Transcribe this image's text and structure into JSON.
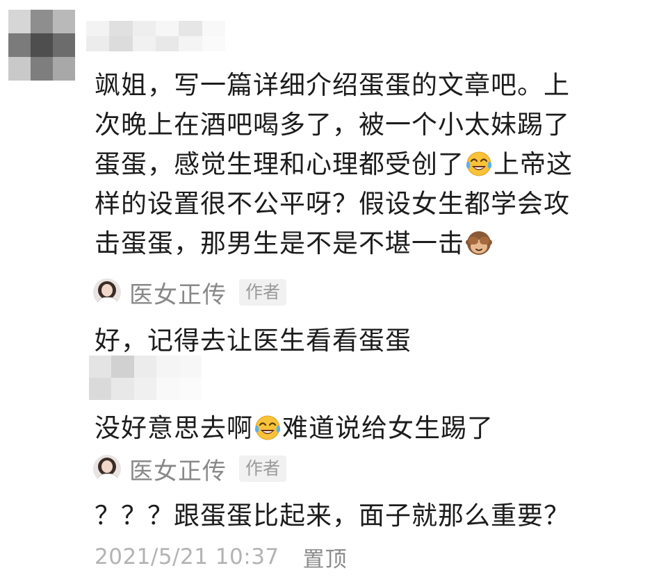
{
  "top_comment": {
    "lines": [
      "飒姐，写一篇详细介绍蛋蛋的文章吧。上",
      "次晚上在酒吧喝多了，被一个小太妹踢了",
      "蛋蛋，感觉生理和心理都受创了",
      "上帝这",
      "样的设置很不公平呀？假设女生都学会攻",
      "击蛋蛋，那男生是不是不堪一击"
    ],
    "emojis": [
      "tears-of-joy-emoji",
      "see-no-evil-monkey-emoji"
    ]
  },
  "author": {
    "name": "医女正传",
    "badge": "作者"
  },
  "replies": [
    {
      "text": "好，记得去让医生看看蛋蛋"
    },
    {
      "text_before": "没好意思去啊",
      "text_after": "难道说给女生踢了",
      "emoji": "tears-of-joy-emoji"
    },
    {
      "text": "？？？跟蛋蛋比起来，面子就那么重要？"
    }
  ],
  "meta": {
    "timestamp": "2021/5/21 10:37",
    "pin_label": "置顶"
  },
  "colors": {
    "text": "#1c1c1c",
    "author_name": "#888888",
    "badge_bg": "#f1f1f1",
    "badge_text": "#9a9a9a",
    "timestamp": "#b3b3b3",
    "pin": "#8b8b8b",
    "emoji_yellow": "#f8c23a"
  },
  "pixelation": {
    "top_avatar": [
      "#d6d6d6",
      "#8e8e8e",
      "#b9b9b9",
      "#7b7b7b",
      "#4e4e4e",
      "#6d6c6c",
      "#c9c9c9",
      "#7e7e7e",
      "#a8a8a8"
    ],
    "top_username": [
      "#f3f3f3",
      "#e0e0e0",
      "#eeeeee",
      "#f6f6f6",
      "#e6e6e6",
      "#f8f8f8",
      "#ececec",
      "#dcdcdc",
      "#f1f1f1",
      "#e8e8e8",
      "#f4f4f4",
      "#fafafa"
    ],
    "reply_avatar": [
      "#e4e4e4",
      "#d1d1d1",
      "#ececec",
      "#f5f5f5",
      "#f7f7f7",
      "#dadada",
      "#e8e8e8",
      "#f0f0f0",
      "#f9f9f9",
      "#fbfbfb"
    ]
  }
}
